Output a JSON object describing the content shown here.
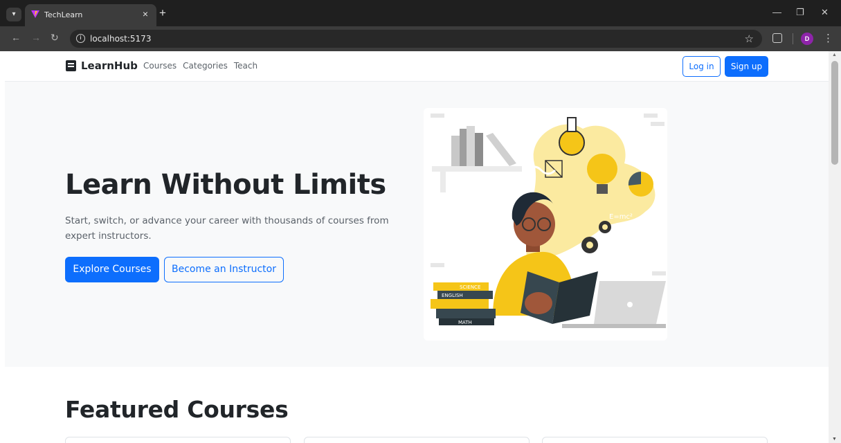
{
  "browser": {
    "tab_title": "TechLearn",
    "url": "localhost:5173",
    "profile_initial": "D"
  },
  "navbar": {
    "brand": "LearnHub",
    "links": [
      "Courses",
      "Categories",
      "Teach"
    ],
    "login_label": "Log in",
    "signup_label": "Sign up"
  },
  "hero": {
    "title": "Learn Without Limits",
    "subtitle": "Start, switch, or advance your career with thousands of courses from expert instructors.",
    "primary_cta": "Explore Courses",
    "secondary_cta": "Become an Instructor",
    "illustration": {
      "book_labels": [
        "SCIENCE",
        "ENGLISH",
        "MATH"
      ],
      "formula": "E=mc²"
    }
  },
  "featured": {
    "title": "Featured Courses"
  },
  "colors": {
    "primary": "#0d6efd",
    "hero_bg": "#f8f9fa",
    "text_dark": "#212529",
    "accent_yellow": "#f5c518"
  }
}
